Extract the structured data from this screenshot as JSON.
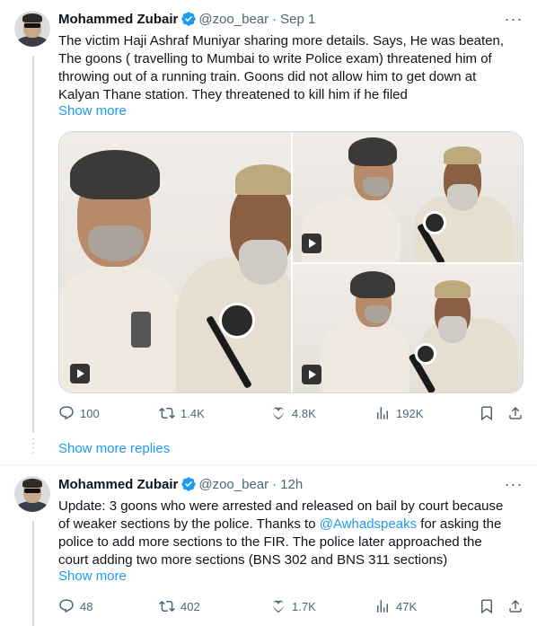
{
  "tweet1": {
    "author": {
      "name": "Mohammed Zubair",
      "handle": "@zoo_bear",
      "time": "Sep 1"
    },
    "text_lines": [
      "The victim Haji Ashraf Muniyar sharing more details. Says, He was beaten,",
      "The goons ( travelling to Mumbai to write Police exam) threatened him of",
      "throwing out of a running train. Goons did not allow him to get down at",
      "Kalyan Thane station. They threatened to kill him if he filed"
    ],
    "show_more": "Show more",
    "media_count": 3,
    "actions": {
      "replies": "100",
      "reposts": "1.4K",
      "likes": "4.8K",
      "views": "192K"
    }
  },
  "show_more_replies": "Show more replies",
  "tweet2": {
    "author": {
      "name": "Mohammed Zubair",
      "handle": "@zoo_bear",
      "time": "12h"
    },
    "line1": "Update:  3 goons who were arrested and released on bail by court because",
    "line2": "of weaker sections by the police. Thanks to ",
    "mention": "@Awhadspeaks",
    "line2_end": " for asking the",
    "line3": "police to add more sections to the FIR.  The police later approached the",
    "line4": "court adding two more sections (BNS 302 and BNS 311 sections)",
    "show_more": "Show more",
    "actions": {
      "replies": "48",
      "reposts": "402",
      "likes": "1.7K",
      "views": "47K"
    }
  },
  "colors": {
    "accent": "#1d9bf0",
    "text": "#0f1419",
    "muted": "#536471",
    "verified": "#1d9bf0"
  },
  "icons": [
    "more-icon",
    "verified-badge-icon",
    "reply-icon",
    "repost-icon",
    "like-icon",
    "views-icon",
    "bookmark-icon",
    "share-icon",
    "play-icon"
  ]
}
